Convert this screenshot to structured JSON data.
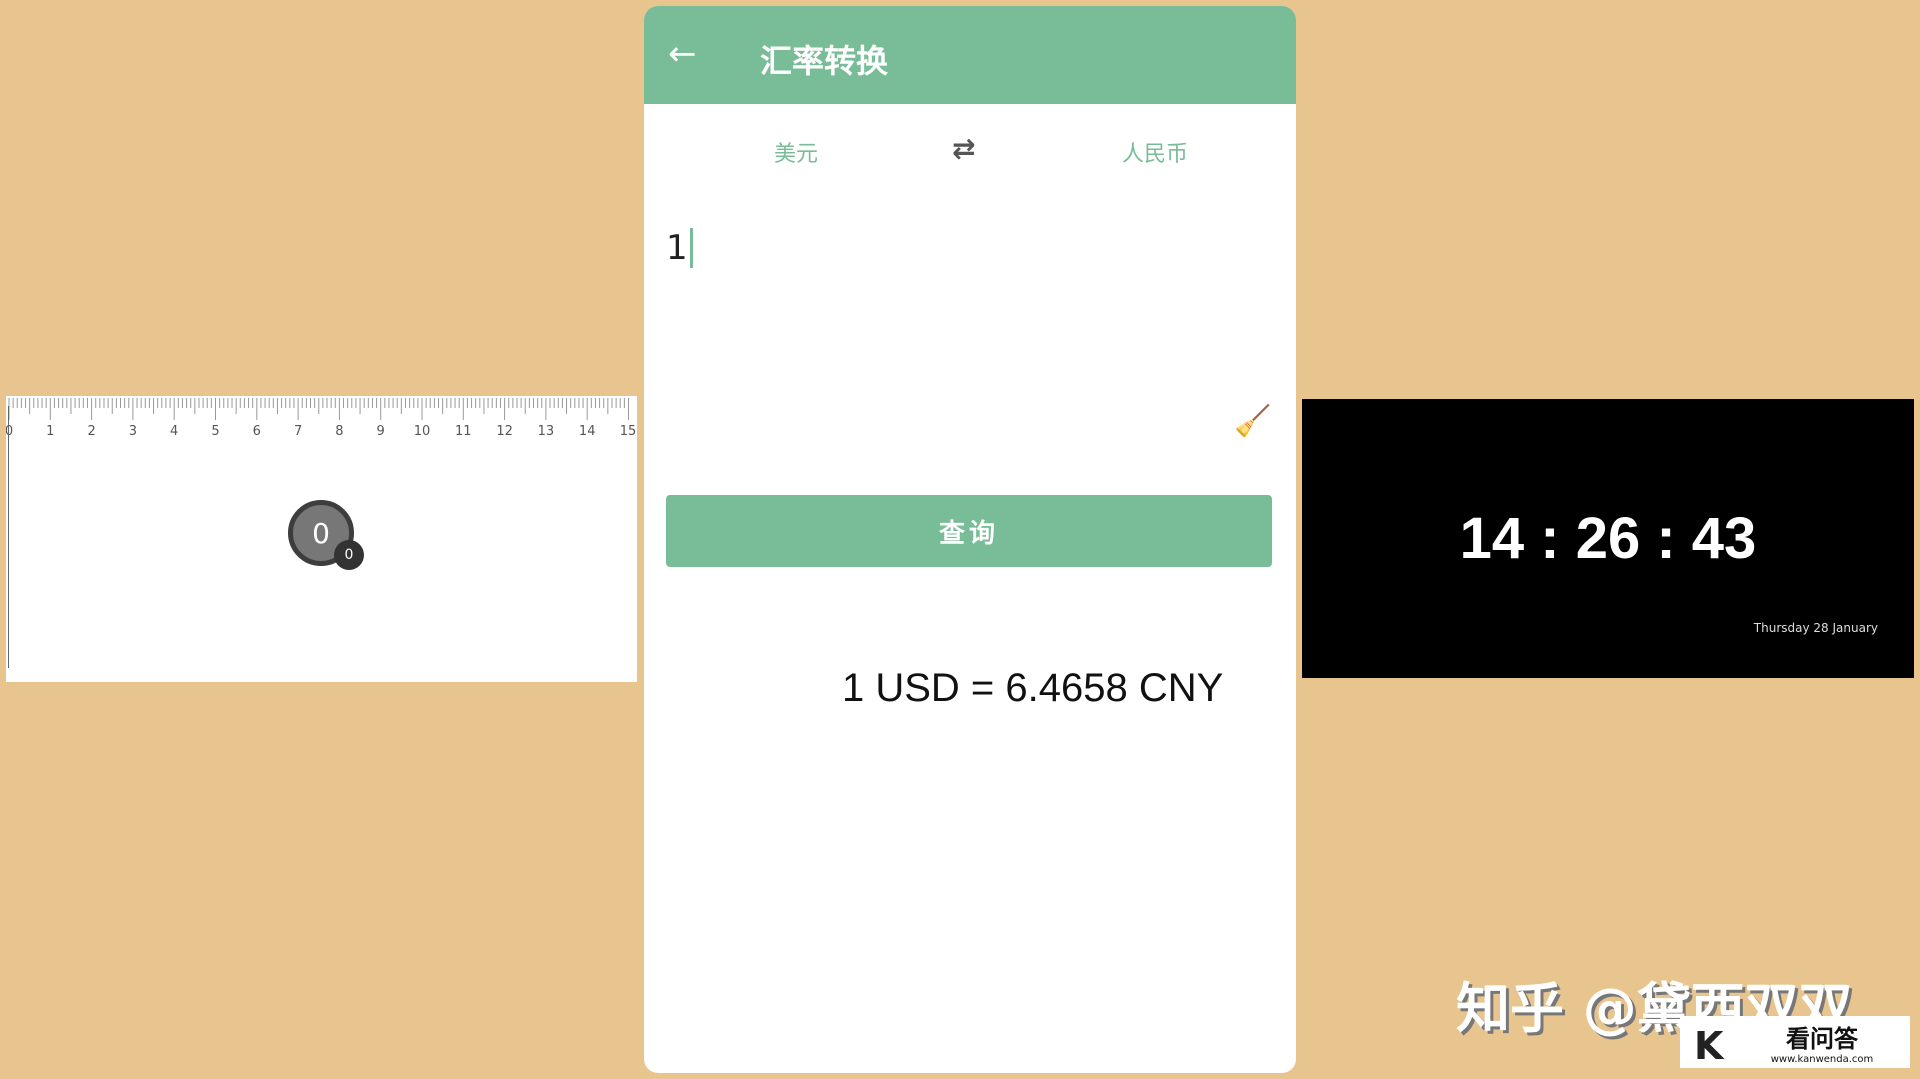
{
  "ruler": {
    "labels": [
      "0",
      "1",
      "2",
      "3",
      "4",
      "5",
      "6",
      "7",
      "8",
      "9",
      "10",
      "11",
      "12",
      "13",
      "14",
      "15"
    ],
    "coin_value": "0",
    "coin_badge": "0"
  },
  "app": {
    "title": "汇率转换",
    "from_currency": "美元",
    "to_currency": "人民币",
    "input_value": "1",
    "query_button": "查询",
    "result": "1 USD = 6.4658 CNY",
    "accent_color": "#79bd98",
    "icons": {
      "back": "arrow-left-icon",
      "swap": "swap-arrows-icon",
      "clear": "broom-icon"
    }
  },
  "clock": {
    "time": "14 : 26 : 43",
    "date": "Thursday 28 January"
  },
  "watermark": {
    "text": "知乎 @黛西双双",
    "site_name": "看问答",
    "site_url": "www.kanwenda.com"
  }
}
